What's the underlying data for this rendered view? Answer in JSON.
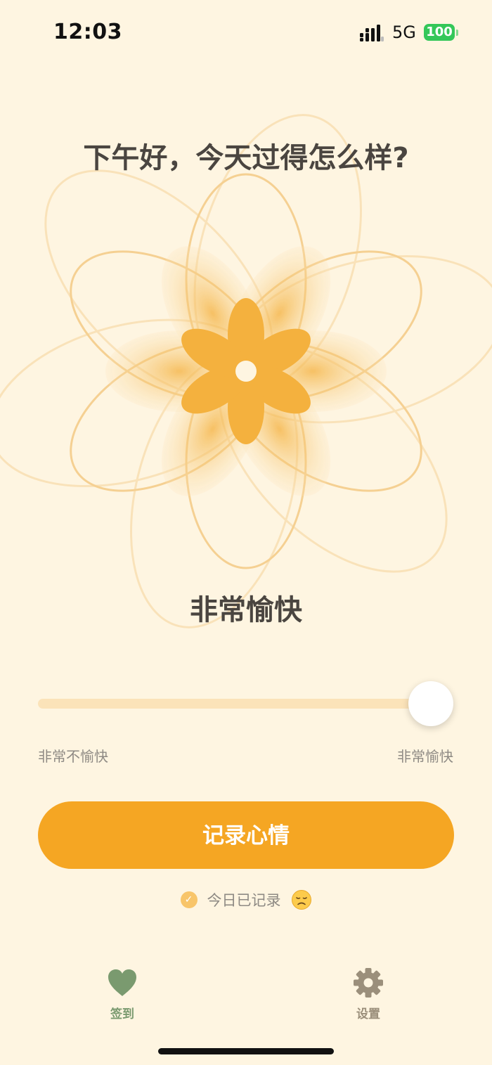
{
  "status_bar": {
    "time": "12:03",
    "network": "5G",
    "battery": "100",
    "battery_color": "#34C759"
  },
  "greeting": "下午好，今天过得怎么样?",
  "mood": {
    "label": "非常愉快",
    "level": 1.0
  },
  "slider": {
    "min_label": "非常不愉快",
    "max_label": "非常愉快"
  },
  "record_button_label": "记录心情",
  "recorded_status": {
    "text": "今日已记录",
    "check_icon": "check-circle-icon",
    "mood_icon": "sad-face-icon"
  },
  "tabs": [
    {
      "label": "签到",
      "icon": "heart-icon",
      "active": true
    },
    {
      "label": "设置",
      "icon": "gear-icon",
      "active": false
    }
  ],
  "colors": {
    "background": "#FEF5E1",
    "accent": "#F5A623",
    "active_tab": "#7A9A6F",
    "inactive_tab": "#9B8F7B"
  }
}
